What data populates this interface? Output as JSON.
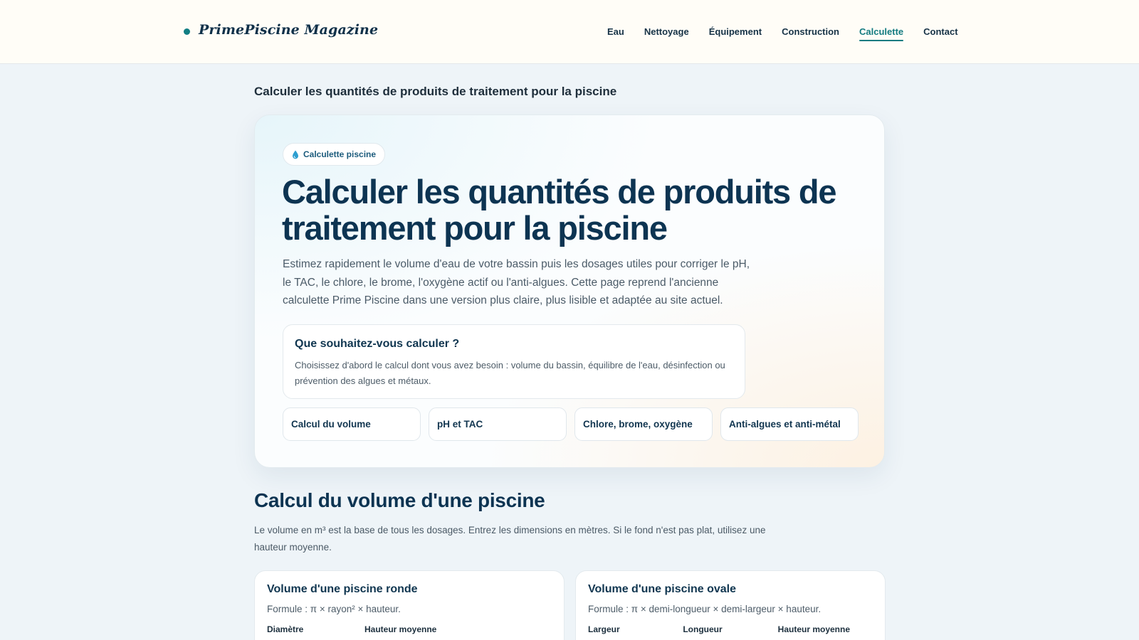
{
  "header": {
    "brand": "PrimePiscine Magazine",
    "nav": [
      {
        "label": "Eau",
        "active": false
      },
      {
        "label": "Nettoyage",
        "active": false
      },
      {
        "label": "Équipement",
        "active": false
      },
      {
        "label": "Construction",
        "active": false
      },
      {
        "label": "Calculette",
        "active": true
      },
      {
        "label": "Contact",
        "active": false
      }
    ]
  },
  "page": {
    "subtitle": "Calculer les quantités de produits de traitement pour la piscine"
  },
  "hero": {
    "badge": "Calculette piscine",
    "badge_icon": "drop-icon",
    "title": "Calculer les quantités de produits de traitement pour la piscine",
    "intro": "Estimez rapidement le volume d'eau de votre bassin puis les dosages utiles pour corriger le pH, le TAC, le chlore, le brome, l'oxygène actif ou l'anti-algues. Cette page reprend l'ancienne calculette Prime Piscine dans une version plus claire, plus lisible et adaptée au site actuel.",
    "question": {
      "title": "Que souhaitez-vous calculer ?",
      "text": "Choisissez d'abord le calcul dont vous avez besoin : volume du bassin, équilibre de l'eau, désinfection ou prévention des algues et métaux."
    },
    "choices": [
      {
        "label": "Calcul du volume"
      },
      {
        "label": "pH et TAC"
      },
      {
        "label": "Chlore, brome, oxygène"
      },
      {
        "label": "Anti-algues et anti-métal"
      }
    ]
  },
  "volume_section": {
    "title": "Calcul du volume d'une piscine",
    "text": "Le volume en m³ est la base de tous les dosages. Entrez les dimensions en mètres. Si le fond n'est pas plat, utilisez une hauteur moyenne.",
    "round": {
      "title": "Volume d'une piscine ronde",
      "formula": "Formule : π × rayon² × hauteur.",
      "fields": [
        "Diamètre",
        "Hauteur moyenne"
      ]
    },
    "oval": {
      "title": "Volume d'une piscine ovale",
      "formula": "Formule : π × demi-longueur × demi-largeur × hauteur.",
      "fields": [
        "Largeur",
        "Longueur",
        "Hauteur moyenne"
      ]
    }
  },
  "colors": {
    "accent": "#137b80",
    "heading": "#0d3452",
    "background": "#eef4f8",
    "header_bg": "#fffdf7"
  }
}
